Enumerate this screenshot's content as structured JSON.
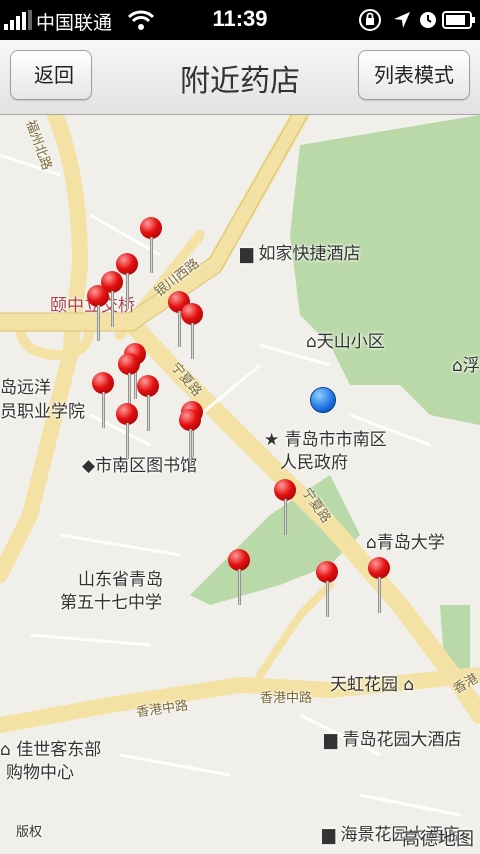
{
  "status_bar": {
    "carrier": "中国联通",
    "time": "11:39"
  },
  "nav": {
    "title": "附近药店",
    "back_label": "返回",
    "list_mode_label": "列表模式"
  },
  "map": {
    "labels": {
      "ruijia_hotel": "如家快捷酒店",
      "tianshan": "天山小区",
      "yizhongli": "颐中立交桥",
      "yuanyang_1": "岛远洋",
      "yuanyang_2": "员职业学院",
      "library": "市南区图书馆",
      "gov_1": "青岛市市南区",
      "gov_2": "人民政府",
      "qdu": "青岛大学",
      "school_1": "山东省青岛",
      "school_2": "第五十七中学",
      "tianhong": "天虹花园",
      "qd_hotel": "青岛花园大酒店",
      "jiashike_1": "佳世客东部",
      "jiashike_2": "购物中心",
      "haijing": "海景花园大酒店",
      "copyright": "版权",
      "gaode": "高德地图",
      "fu": "浮",
      "road_yinchuan": "银川西路",
      "road_fuzhou": "福州北路",
      "road_ningxia": "宁夏路",
      "road_ningxia2": "宁夏路",
      "road_xianggang": "香港中路",
      "road_xianggang2": "香港中路",
      "road_xiangg3": "香港"
    }
  }
}
